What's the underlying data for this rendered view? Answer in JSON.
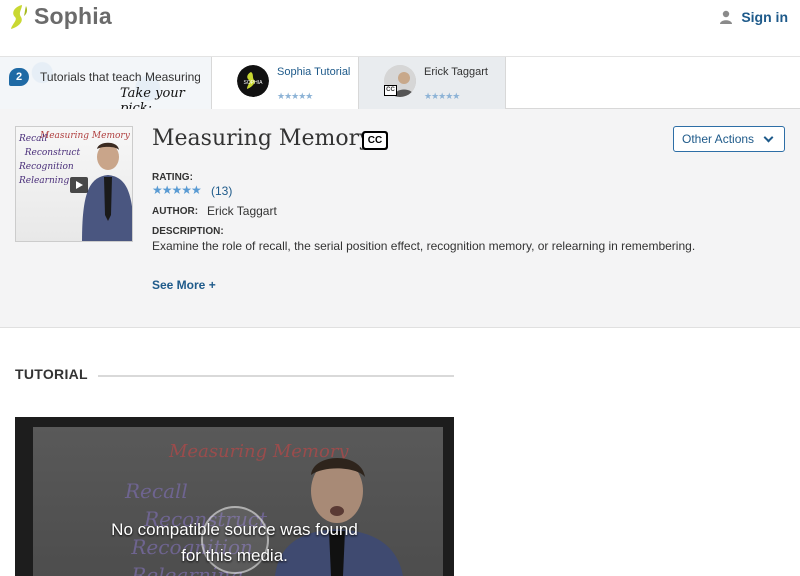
{
  "header": {
    "brand": "Sophia",
    "signin_label": "Sign in"
  },
  "picker": {
    "count": "2",
    "intro_text": "Tutorials that teach Measuring Memory",
    "intro_pick": "Take your pick:",
    "cards": [
      {
        "author": "Sophia Tutorial",
        "stars": "★★★★★"
      },
      {
        "author": "Erick Taggart",
        "stars": "★★★★★",
        "cc": "CC"
      }
    ]
  },
  "details": {
    "title": "Measuring Memory",
    "cc": "CC",
    "other_actions": "Other Actions",
    "rating_label": "RATING:",
    "stars": "★★★★★",
    "rating_count": "(13)",
    "author_label": "AUTHOR:",
    "author": "Erick Taggart",
    "description_label": "DESCRIPTION:",
    "description": "Examine the role of recall, the serial position effect, recognition memory, or relearning in remembering.",
    "see_more": "See More +",
    "thumb_title": "Measuring Memory",
    "thumb_words": "Recall\n  Reconstruct\nRecognition\nRelearning"
  },
  "tutorial": {
    "heading": "TUTORIAL",
    "board_title": "Measuring Memory",
    "board_words": "Recall\n   Reconstruct\n Recognition\n Relearning",
    "message_line1": "No compatible source was found",
    "message_line2": "for this media."
  },
  "colors": {
    "brand_green": "#c9d832",
    "link_blue": "#1e5a8a",
    "star_blue": "#5a9bd3"
  }
}
